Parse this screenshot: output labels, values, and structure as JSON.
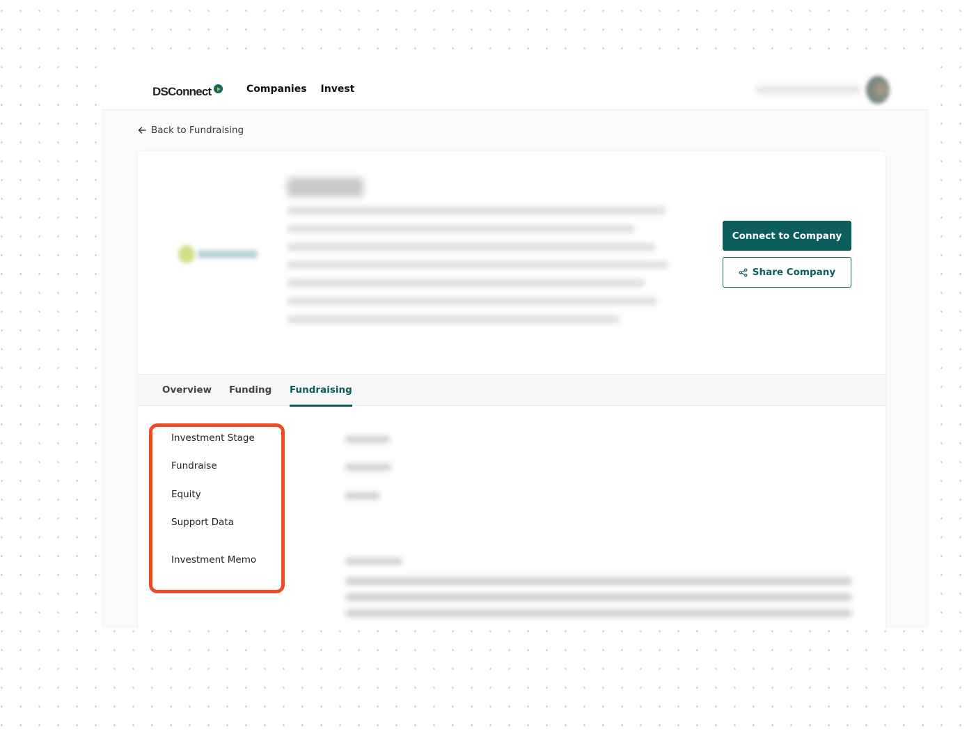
{
  "header": {
    "logo_text": "DSConnect",
    "nav": [
      {
        "label": "Companies"
      },
      {
        "label": "Invest"
      }
    ],
    "user": {
      "name_blurred": true,
      "avatar": "user-avatar"
    }
  },
  "back_link": {
    "label": "Back to Fundraising",
    "icon": "arrow-left-icon"
  },
  "company": {
    "name_blurred": true,
    "description_blurred": true,
    "logo_blurred": true
  },
  "actions": {
    "connect_label": "Connect to Company",
    "share_label": "Share Company",
    "share_icon": "share-icon"
  },
  "tabs": [
    {
      "label": "Overview",
      "active": false
    },
    {
      "label": "Funding",
      "active": false
    },
    {
      "label": "Fundraising",
      "active": true
    }
  ],
  "fundraising": {
    "fields": [
      {
        "label": "Investment Stage",
        "value_blurred": true
      },
      {
        "label": "Fundraise",
        "value_blurred": true
      },
      {
        "label": "Equity",
        "value_blurred": true
      },
      {
        "label": "Support Data",
        "value_blurred": false
      },
      {
        "label": "Investment Memo",
        "value_blurred": true
      }
    ],
    "description_blurred": true
  },
  "annotation": {
    "color": "#f04a23",
    "target": "fundraising-field-labels"
  },
  "colors": {
    "brand": "#0b5e5b",
    "logo_accent": "#f3a21b",
    "highlight": "#f04a23"
  }
}
